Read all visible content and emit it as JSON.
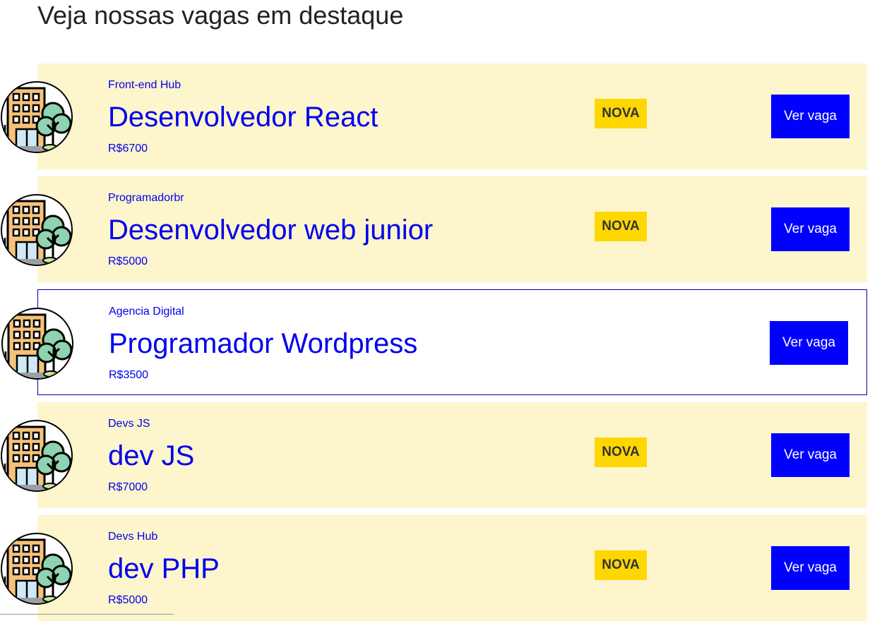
{
  "page": {
    "title": "Veja nossas vagas em destaque"
  },
  "jobs": [
    {
      "company": "Front-end Hub",
      "title": "Desenvolvedor React",
      "salary": "R$6700",
      "badge": "NOVA",
      "button": "Ver vaga",
      "logo_icon": "building-tree-icon"
    },
    {
      "company": "Programadorbr",
      "title": "Desenvolvedor web junior",
      "salary": "R$5000",
      "badge": "NOVA",
      "button": "Ver vaga",
      "logo_icon": "building-tree-icon"
    },
    {
      "company": "Agencia Digital",
      "title": "Programador Wordpress",
      "salary": "R$3500",
      "badge": "",
      "button": "Ver vaga",
      "logo_icon": "building-tree-icon"
    },
    {
      "company": "Devs JS",
      "title": "dev JS",
      "salary": "R$7000",
      "badge": "NOVA",
      "button": "Ver vaga",
      "logo_icon": "building-tree-icon"
    },
    {
      "company": "Devs Hub",
      "title": "dev PHP",
      "salary": "R$5000",
      "badge": "NOVA",
      "button": "Ver vaga",
      "logo_icon": "building-tree-icon"
    }
  ],
  "colors": {
    "card_bg": "#fdf5cc",
    "link": "#0000ee",
    "badge_bg": "#ffd700",
    "button_bg": "#0000ff",
    "outline": "#0000a0"
  }
}
